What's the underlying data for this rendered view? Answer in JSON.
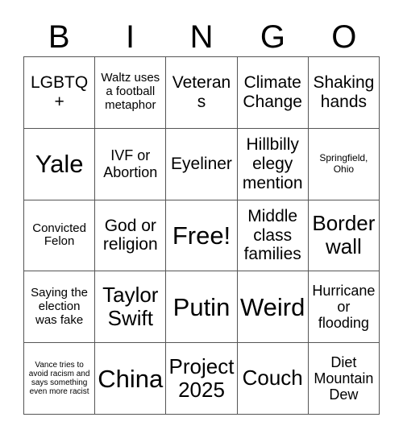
{
  "card": {
    "header_letters": [
      "B",
      "I",
      "N",
      "G",
      "O"
    ],
    "rows": [
      [
        {
          "text": "LGBTQ+",
          "size": "fs-l"
        },
        {
          "text": "Waltz uses a football metaphor",
          "size": "fs-s"
        },
        {
          "text": "Veterans",
          "size": "fs-l"
        },
        {
          "text": "Climate Change",
          "size": "fs-l"
        },
        {
          "text": "Shaking hands",
          "size": "fs-l"
        }
      ],
      [
        {
          "text": "Yale",
          "size": "fs-xxl"
        },
        {
          "text": "IVF or Abortion",
          "size": "fs-m"
        },
        {
          "text": "Eyeliner",
          "size": "fs-l"
        },
        {
          "text": "Hillbilly elegy mention",
          "size": "fs-l"
        },
        {
          "text": "Springfield, Ohio",
          "size": "fs-xs"
        }
      ],
      [
        {
          "text": "Convicted Felon",
          "size": "fs-s"
        },
        {
          "text": "God or religion",
          "size": "fs-l"
        },
        {
          "text": "Free!",
          "size": "fs-xxl"
        },
        {
          "text": "Middle class families",
          "size": "fs-l"
        },
        {
          "text": "Border wall",
          "size": "fs-xl"
        }
      ],
      [
        {
          "text": "Saying the election was fake",
          "size": "fs-s"
        },
        {
          "text": "Taylor Swift",
          "size": "fs-xl"
        },
        {
          "text": "Putin",
          "size": "fs-xxl"
        },
        {
          "text": "Weird",
          "size": "fs-xxl"
        },
        {
          "text": "Hurricane or flooding",
          "size": "fs-m"
        }
      ],
      [
        {
          "text": "Vance tries to avoid racism and says something even more racist",
          "size": "fs-xxs"
        },
        {
          "text": "China",
          "size": "fs-xxl"
        },
        {
          "text": "Project 2025",
          "size": "fs-xl"
        },
        {
          "text": "Couch",
          "size": "fs-xl"
        },
        {
          "text": "Diet Mountain Dew",
          "size": "fs-m"
        }
      ]
    ],
    "colors": {
      "background": "#ffffff",
      "text": "#000000",
      "border": "#555555"
    }
  }
}
